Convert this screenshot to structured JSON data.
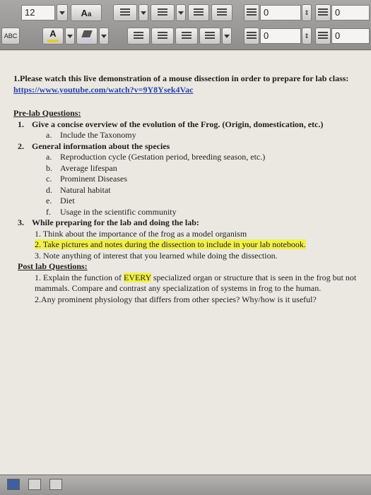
{
  "toolbar": {
    "font_size": "12",
    "font_size_options": [],
    "styles_icon": "text-styles-icon",
    "char_style_label": "ABC",
    "highlight_label": "A",
    "indent_left_value": "0",
    "indent_right_value": "0",
    "spacing_before_value": "0",
    "spacing_after_value": "0",
    "accent_color": "#e6c93a"
  },
  "document": {
    "intro_number": "1.",
    "intro_text": "Please watch this live demonstration of a mouse dissection in order to prepare for lab class: ",
    "intro_link": "https://www.youtube.com/watch?v=9Y8Ysek4Vac",
    "prelab_heading": "Pre-lab Questions:",
    "q1_num": "1.",
    "q1_text": "Give a concise overview of the evolution of the Frog. (Origin, domestication, etc.)",
    "q1a_num": "a.",
    "q1a_text": "Include the Taxonomy",
    "q2_num": "2.",
    "q2_text": "General information about the species",
    "q2_items": [
      {
        "num": "a.",
        "text": "Reproduction cycle (Gestation period, breeding season, etc.)"
      },
      {
        "num": "b.",
        "text": "Average lifespan"
      },
      {
        "num": "c.",
        "text": "Prominent Diseases"
      },
      {
        "num": "d.",
        "text": "Natural habitat"
      },
      {
        "num": "e.",
        "text": "Diet"
      },
      {
        "num": "f.",
        "text": "Usage in the scientific community"
      }
    ],
    "q3_num": "3.",
    "q3_text": "While preparing for the lab and doing the lab:",
    "q3_1": "1. Think about the importance of the frog as a model organism",
    "q3_2": "2. Take pictures and notes during the dissection to include in your lab notebook.",
    "q3_3": "3.  Note anything of interest that you learned while doing the dissection.",
    "postlab_heading": "Post lab Questions:",
    "post_1_pre": "1. Explain the function of ",
    "post_1_hl": "EVERY",
    "post_1_post": " specialized organ or structure that is seen in the frog but not mammals. Compare and contrast any specialization of systems in frog to the human.",
    "post_2": "2.Any prominent physiology that differs from other species? Why/how is it useful?"
  },
  "statusbar": {
    "view_icons": [
      "normal-view-icon",
      "layout-view-icon",
      "notebook-view-icon"
    ]
  }
}
